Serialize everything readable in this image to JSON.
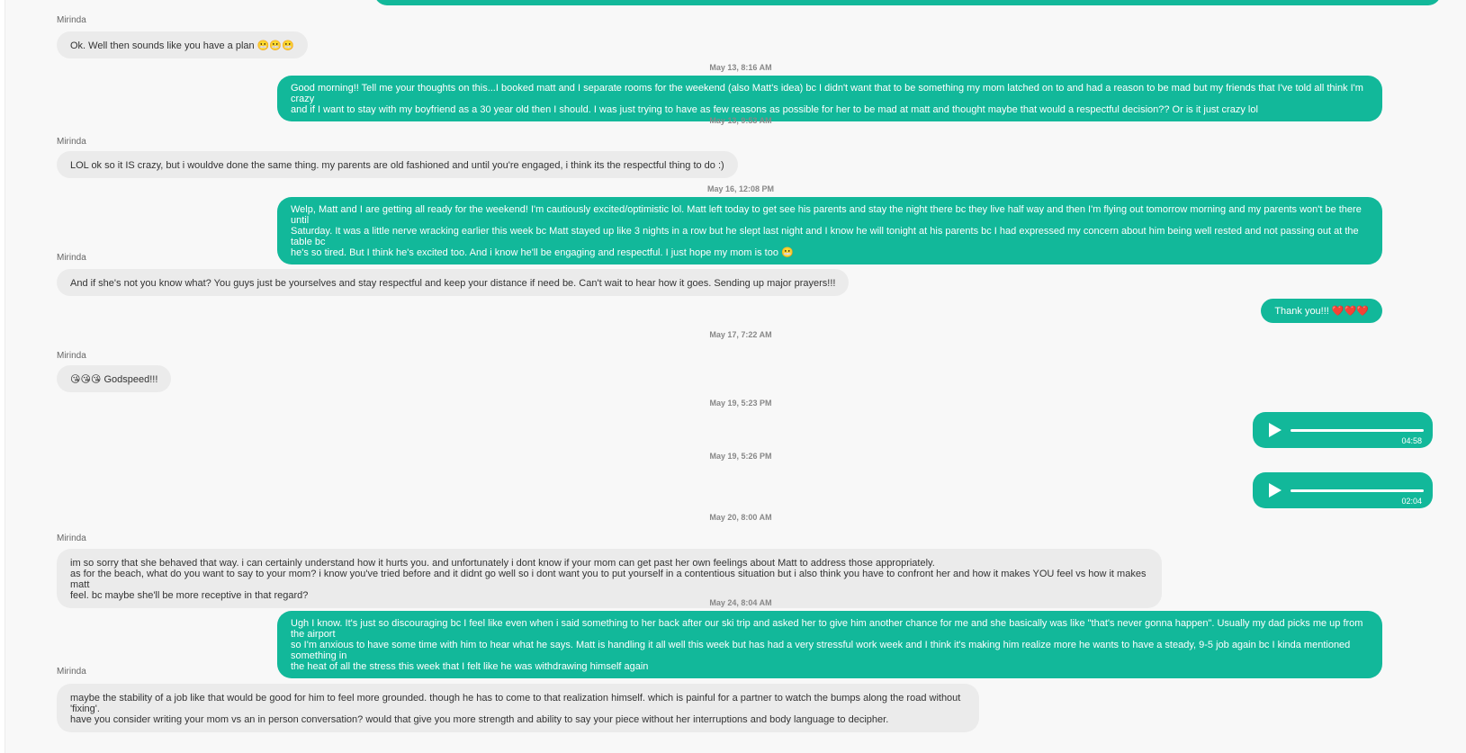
{
  "messages": [
    {
      "kind": "sender",
      "text": "Mirinda"
    },
    {
      "kind": "in",
      "text": "Ok. Well then sounds like you have a plan 😬😬😬"
    },
    {
      "kind": "timestamp",
      "text": "May 13, 8:16 AM"
    },
    {
      "kind": "out",
      "text": "Good morning!! Tell me your thoughts on this...I booked matt and I separate rooms for the weekend (also Matt's idea) bc I didn't want that to be something my mom latched on to and had a reason to be mad but my friends that I've told all think I'm crazy\nand if I want to stay with my boyfriend as a 30 year old then I should. I was just trying to have as few reasons as possible for her to be mad at matt and thought maybe that would a respectful decision?? Or is it just crazy lol"
    },
    {
      "kind": "timestamp",
      "text": "May 13, 9:53 AM"
    },
    {
      "kind": "sender",
      "text": "Mirinda"
    },
    {
      "kind": "in",
      "text": "LOL ok so it IS crazy, but i wouldve done the same thing. my parents are old fashioned and until you're engaged, i think its the respectful thing to do :)"
    },
    {
      "kind": "timestamp",
      "text": "May 16, 12:08 PM"
    },
    {
      "kind": "out",
      "text": "Welp, Matt and I are getting all ready for the weekend! I'm cautiously excited/optimistic lol. Matt left today to get see his parents and stay the night there bc they live half way and then I'm flying out tomorrow morning and my parents won't be there until\nSaturday. It was a little nerve wracking earlier this week bc Matt stayed up like 3 nights in a row but he slept last night and I know he will tonight at his parents bc I had expressed my concern about him being well rested and not passing out at the table bc\nhe's so tired. But I think he's excited too. And i know he'll be engaging and respectful. I just hope my mom is too 😬"
    },
    {
      "kind": "sender",
      "text": "Mirinda"
    },
    {
      "kind": "in",
      "text": "And if she's not you know what? You guys just be yourselves and stay respectful and keep your distance if need be. Can't wait to hear how it goes. Sending up major prayers!!!"
    },
    {
      "kind": "out",
      "text": "Thank you!!! ❤️❤️❤️"
    },
    {
      "kind": "timestamp",
      "text": "May 17, 7:22 AM"
    },
    {
      "kind": "sender",
      "text": "Mirinda"
    },
    {
      "kind": "in",
      "text": "😘😘😘 Godspeed!!!"
    },
    {
      "kind": "timestamp",
      "text": "May 19, 5:23 PM"
    },
    {
      "kind": "audio",
      "text": "04:58"
    },
    {
      "kind": "timestamp",
      "text": "May 19, 5:26 PM"
    },
    {
      "kind": "audio",
      "text": "02:04"
    },
    {
      "kind": "timestamp",
      "text": "May 20, 8:00 AM"
    },
    {
      "kind": "sender",
      "text": "Mirinda"
    },
    {
      "kind": "in",
      "text": "im so sorry that she behaved that way. i can certainly understand how it hurts you. and unfortunately i dont know if your mom can get past her own feelings about Matt to address those appropriately.\nas for the beach, what do you want to say to your mom? i know you've tried before and it didnt go well so i dont want you to put yourself in a contentious situation but i also think you have to confront her and how it makes YOU feel vs how it makes matt\nfeel. bc maybe she'll be more receptive in that regard?"
    },
    {
      "kind": "timestamp",
      "text": "May 24, 8:04 AM"
    },
    {
      "kind": "out",
      "text": "Ugh I know. It's just so discouraging bc I feel like even when i said something to her back after our ski trip and asked her to give him another chance for me and she basically was like \"that's never gonna happen\". Usually my dad picks me up from the airport\nso I'm anxious to have some time with him to hear what he says. Matt is handling it all well this week but has had a very stressful work week and I think it's making him realize more he wants to have a steady, 9-5 job again bc I kinda mentioned something in\nthe heat of all the stress this week that I felt like he was withdrawing himself again"
    },
    {
      "kind": "sender",
      "text": "Mirinda"
    },
    {
      "kind": "in",
      "text": "maybe the stability of a job like that would be good for him to feel more grounded. though he has to come to that realization himself. which is painful for a partner to watch the bumps along the road without 'fixing'.\nhave you consider writing your mom vs an in person conversation? would that give you more strength and ability to say your piece without her interruptions and body language to decipher."
    }
  ]
}
